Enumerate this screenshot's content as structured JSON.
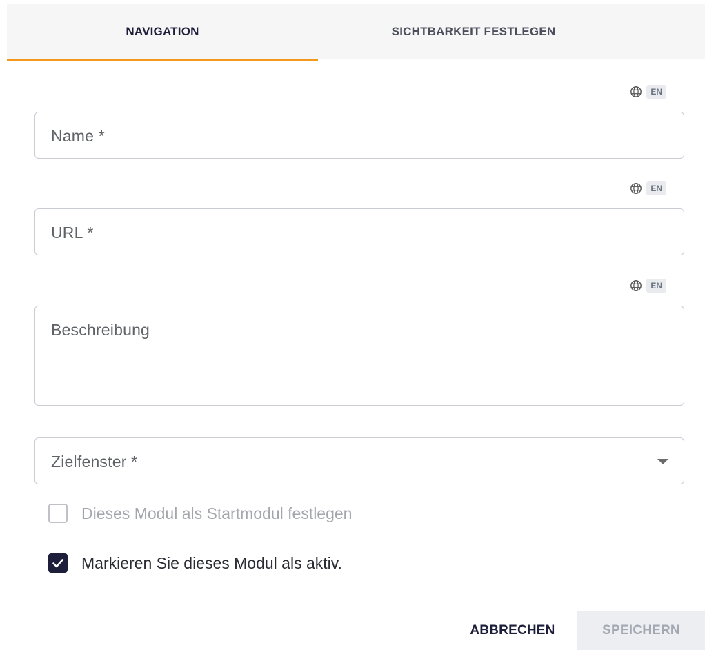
{
  "tabs": [
    {
      "label": "NAVIGATION",
      "active": true
    },
    {
      "label": "SICHTBARKEIT FESTLEGEN",
      "active": false
    }
  ],
  "language_badge": "EN",
  "fields": {
    "name": {
      "placeholder": "Name *",
      "value": ""
    },
    "url": {
      "placeholder": "URL *",
      "value": ""
    },
    "description": {
      "placeholder": "Beschreibung",
      "value": ""
    },
    "target_window": {
      "placeholder": "Zielfenster *",
      "value": ""
    }
  },
  "checkboxes": {
    "start_module": {
      "label": "Dieses Modul als Startmodul festlegen",
      "checked": false,
      "disabled": true
    },
    "active": {
      "label": "Markieren Sie dieses Modul als aktiv.",
      "checked": true,
      "disabled": false
    }
  },
  "actions": {
    "cancel_label": "ABBRECHEN",
    "save_label": "SPEICHERN"
  },
  "colors": {
    "accent": "#f39a1c",
    "primary": "#1d1f3a"
  },
  "icons": {
    "language": "globe-icon",
    "select": "chevron-down-icon",
    "check": "check-icon"
  }
}
